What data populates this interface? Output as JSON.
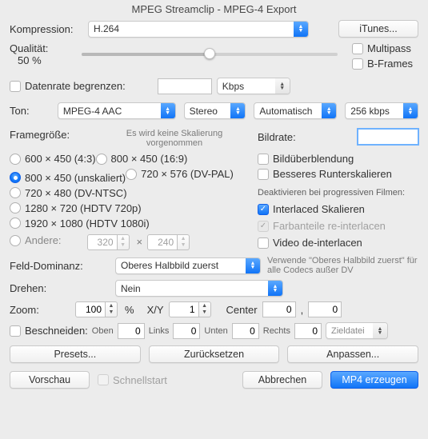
{
  "window": {
    "title": "MPEG Streamclip - MPEG-4 Export"
  },
  "compression": {
    "label": "Kompression:",
    "value": "H.264",
    "itunes_button": "iTunes..."
  },
  "quality": {
    "label": "Qualität:",
    "percent_text": "50 %",
    "slider_percent": 50
  },
  "multipass": {
    "label": "Multipass",
    "checked": false
  },
  "bframes": {
    "label": "B-Frames",
    "checked": false
  },
  "datarate": {
    "label": "Datenrate begrenzen:",
    "checked": false,
    "value": "",
    "unit": {
      "value": "Kbps"
    }
  },
  "audio": {
    "label": "Ton:",
    "codec": "MPEG-4 AAC",
    "channels": "Stereo",
    "mode": "Automatisch",
    "bitrate": "256 kbps"
  },
  "framesize": {
    "label": "Framegröße:",
    "note": "Es wird keine Skalierung vorgenommen",
    "items": [
      {
        "text": "600 × 450   (4:3)"
      },
      {
        "text": "800 × 450   (16:9)"
      },
      {
        "text": "800 × 450   (unskaliert)"
      },
      {
        "text": "720 × 576   (DV-PAL)"
      },
      {
        "text": "720 × 480   (DV-NTSC)"
      },
      {
        "text": "1280 × 720   (HDTV 720p)"
      },
      {
        "text": "1920 × 1080   (HDTV 1080i)"
      }
    ],
    "selected_index": 2,
    "other": {
      "label": "Andere:",
      "w": "320",
      "h": "240"
    }
  },
  "bildrate": {
    "label": "Bildrate:",
    "value": "",
    "blend": {
      "label": "Bildüberblendung",
      "checked": false
    },
    "downscale": {
      "label": "Besseres Runterskalieren",
      "checked": false
    }
  },
  "deinterlace": {
    "heading": "Deaktivieren bei progressiven Filmen:",
    "interlaced": {
      "label": "Interlaced Skalieren",
      "checked": true
    },
    "reinterlace": {
      "label": "Farbanteile re-interlacen",
      "checked": true,
      "disabled": true
    },
    "video": {
      "label": "Video de-interlacen",
      "checked": false
    }
  },
  "field_dominance": {
    "label": "Feld-Dominanz:",
    "value": "Oberes Halbbild zuerst",
    "hint": "Verwende \"Oberes Halbbild zuerst\" für alle Codecs außer DV"
  },
  "rotate": {
    "label": "Drehen:",
    "value": "Nein"
  },
  "zoom": {
    "label": "Zoom:",
    "percent": "100",
    "percent_sym": "%",
    "xy_label": "X/Y",
    "xy": "1",
    "center_label": "Center",
    "cx": "0",
    "cy": "0"
  },
  "crop": {
    "label": "Beschneiden:",
    "checked": false,
    "top_label": "Oben",
    "top": "0",
    "left_label": "Links",
    "left": "0",
    "bottom_label": "Unten",
    "bottom": "0",
    "right_label": "Rechts",
    "right": "0",
    "target_label": "Zieldatei"
  },
  "buttons": {
    "presets": "Presets...",
    "reset": "Zurücksetzen",
    "adjust": "Anpassen..."
  },
  "bottom": {
    "preview": "Vorschau",
    "schnellstart": {
      "label": "Schnellstart",
      "disabled": true
    },
    "cancel": "Abbrechen",
    "make": "MP4 erzeugen"
  }
}
